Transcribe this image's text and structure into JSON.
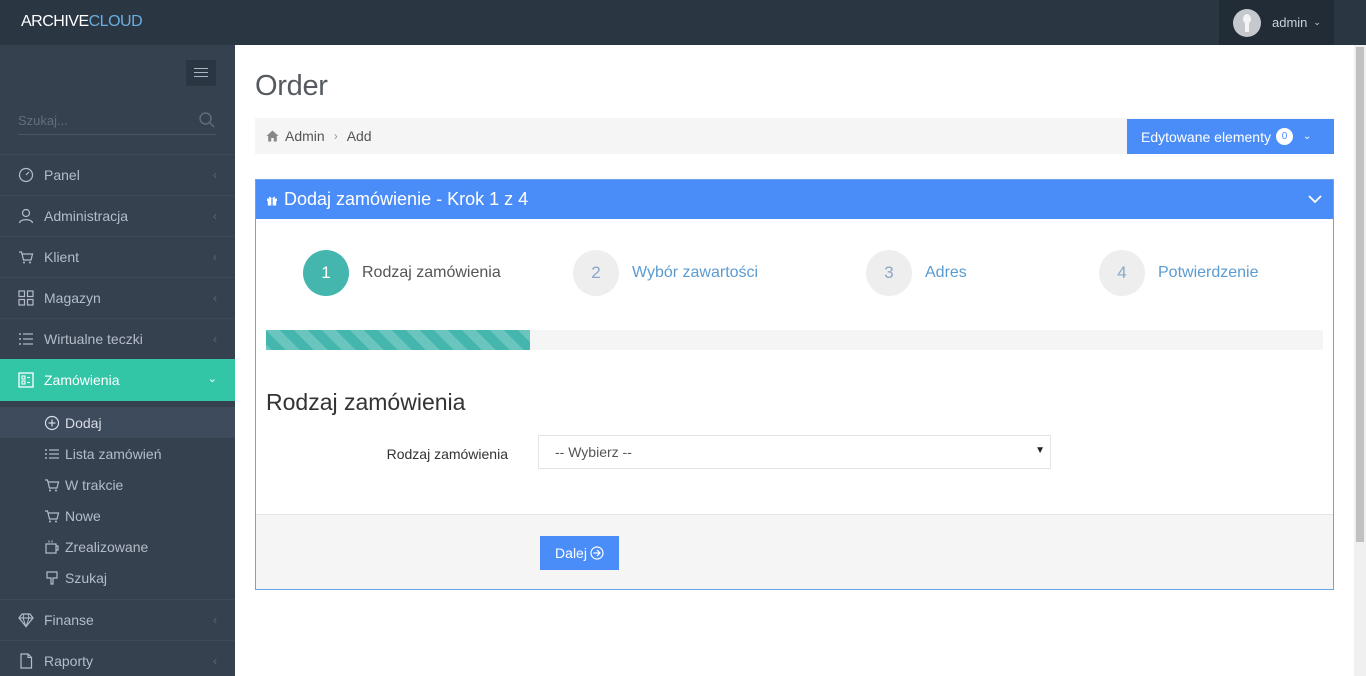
{
  "app": {
    "logo_part1": "ARCHIVE",
    "logo_part2": "CLOUD"
  },
  "user": {
    "name": "admin"
  },
  "sidebar": {
    "search_placeholder": "Szukaj...",
    "items": [
      {
        "label": "Panel",
        "icon": "dashboard-icon"
      },
      {
        "label": "Administracja",
        "icon": "user-icon"
      },
      {
        "label": "Klient",
        "icon": "cart-icon"
      },
      {
        "label": "Magazyn",
        "icon": "grid-icon"
      },
      {
        "label": "Wirtualne teczki",
        "icon": "list-icon"
      },
      {
        "label": "Zamówienia",
        "icon": "orders-icon"
      },
      {
        "label": "Finanse",
        "icon": "diamond-icon"
      },
      {
        "label": "Raporty",
        "icon": "document-icon"
      }
    ],
    "subitems": [
      {
        "label": "Dodaj",
        "icon": "plus-circle-icon"
      },
      {
        "label": "Lista zamówień",
        "icon": "list-icon"
      },
      {
        "label": "W trakcie",
        "icon": "cart-icon"
      },
      {
        "label": "Nowe",
        "icon": "cart-icon"
      },
      {
        "label": "Zrealizowane",
        "icon": "cup-icon"
      },
      {
        "label": "Szukaj",
        "icon": "pin-icon"
      }
    ]
  },
  "page": {
    "title": "Order",
    "breadcrumb": [
      "Admin",
      "Add"
    ],
    "edited_button": "Edytowane elementy",
    "edited_count": "0"
  },
  "wizard": {
    "title": "Dodaj zamówienie - Krok 1 z 4",
    "steps": [
      {
        "num": "1",
        "label": "Rodzaj zamówienia",
        "done": true
      },
      {
        "num": "2",
        "label": "Wybór zawartości",
        "done": false
      },
      {
        "num": "3",
        "label": "Adres",
        "done": false
      },
      {
        "num": "4",
        "label": "Potwierdzenie",
        "done": false
      }
    ],
    "progress": 0.25,
    "section_title": "Rodzaj zamówienia",
    "field_label": "Rodzaj zamówienia",
    "field_value": "-- Wybierz --",
    "next_button": "Dalej"
  },
  "colors": {
    "accent": "#32c5a6",
    "primary": "#4b8df8",
    "sidebar": "#364150",
    "topbar": "#2b3643"
  }
}
